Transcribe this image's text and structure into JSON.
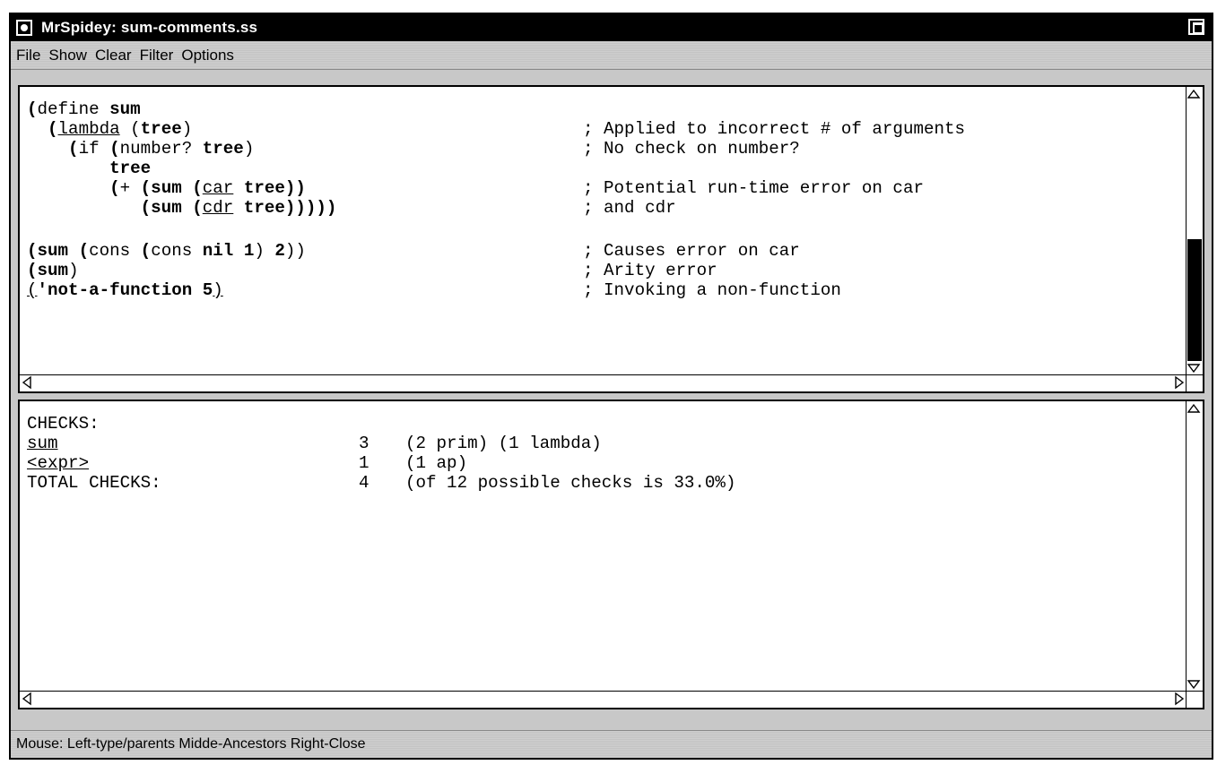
{
  "window": {
    "title": "MrSpidey: sum-comments.ss"
  },
  "menu": [
    "File",
    "Show",
    "Clear",
    "Filter",
    "Options"
  ],
  "code": {
    "l1": {
      "p1": "(",
      "p2": "define ",
      "p3": "sum"
    },
    "l2": {
      "p1": "  (",
      "p2": "lambda",
      "p3": " (",
      "p4": "tree",
      "p5": ")",
      "c": "; Applied to incorrect # of arguments"
    },
    "l3": {
      "p1": "    (",
      "p2": "if ",
      "p3": "(",
      "p4": "number? ",
      "p5": "tree",
      "p6": ")",
      "c": "; No check on number?"
    },
    "l4": {
      "p1": "        tree"
    },
    "l5": {
      "p1": "        (",
      "p2": "+ ",
      "p3": "(sum (",
      "p4": "car",
      "p5": " tree",
      "p6": "))",
      "c": "; Potential run-time error on car"
    },
    "l6": {
      "p1": "           (sum (",
      "p2": "cdr",
      "p3": " tree",
      "p4": ")))))",
      "c": "; and cdr"
    },
    "l7": {
      "p1": "(sum (",
      "p2": "cons ",
      "p3": "(",
      "p4": "cons ",
      "p5": "nil 1",
      "p6": ") ",
      "p7": "2",
      "p8": "))",
      "c": "; Causes error on car"
    },
    "l8": {
      "p1": "(sum",
      "p2": ")",
      "c": "; Arity error"
    },
    "l9": {
      "p1": "(",
      "p2": "'not-a-function 5",
      "p3": ")",
      "c": "; Invoking a non-function"
    }
  },
  "checks": {
    "header": "CHECKS:",
    "rows": [
      {
        "name": "sum",
        "count": "3",
        "detail": "(2 prim) (1 lambda)"
      },
      {
        "name": "<expr>",
        "count": "1",
        "detail": "(1 ap)"
      },
      {
        "name": "TOTAL CHECKS:",
        "count": "4",
        "detail": "(of 12 possible checks is 33.0%)"
      }
    ]
  },
  "status": "Mouse: Left-type/parents  Midde-Ancestors  Right-Close"
}
